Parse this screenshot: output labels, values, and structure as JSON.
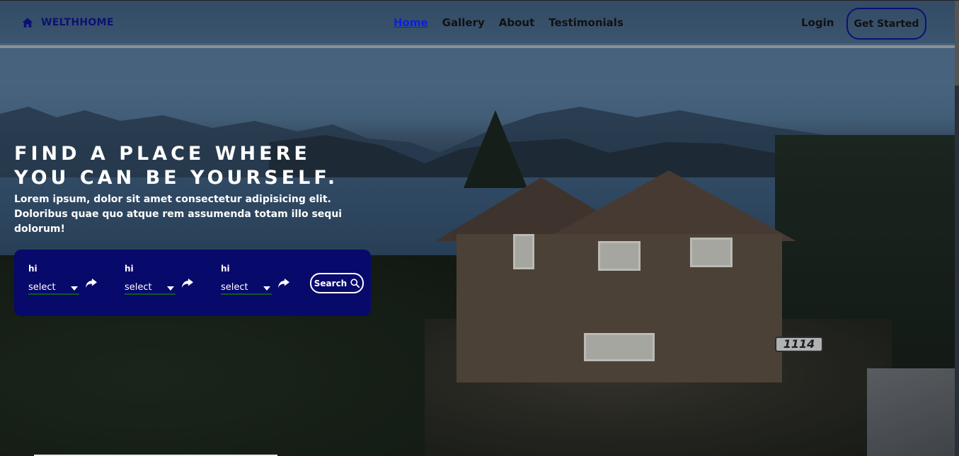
{
  "navbar": {
    "brand": "WELTHHOME",
    "links": [
      {
        "label": "Home",
        "active": true
      },
      {
        "label": "Gallery",
        "active": false
      },
      {
        "label": "About",
        "active": false
      },
      {
        "label": "Testimonials",
        "active": false
      }
    ],
    "login": "Login",
    "cta": "Get Started",
    "brand_icon": "home-icon"
  },
  "hero": {
    "title_line1": "FIND A PLACE WHERE",
    "title_line2": "YOU CAN BE YOURSELF.",
    "subtitle": "Lorem ipsum, dolor sit amet consectetur adipisicing elit. Doloribus quae quo atque rem assumenda totam illo sequi dolorum!",
    "house_number": "1114"
  },
  "search": {
    "filters": [
      {
        "label": "hi",
        "value": "select"
      },
      {
        "label": "hi",
        "value": "select"
      },
      {
        "label": "hi",
        "value": "select"
      }
    ],
    "button_label": "Search",
    "button_icon": "search-icon",
    "filter_icon": "share-arrow-icon"
  },
  "colors": {
    "brand": "#0a1175",
    "active_link": "#0a1ee8",
    "panel": "#07096b",
    "select_underline": "#0d5a1d"
  }
}
